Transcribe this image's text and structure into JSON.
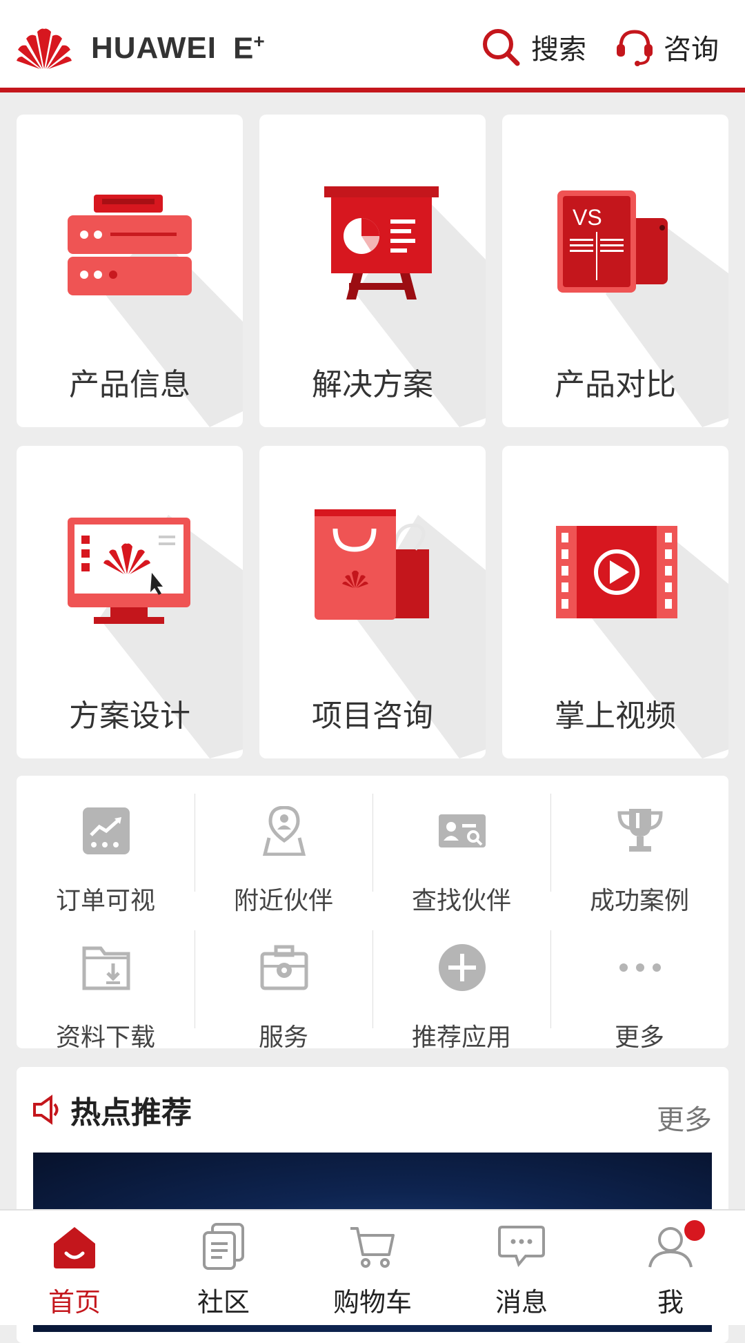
{
  "brand": {
    "name": "HUAWEI",
    "suffix": "E",
    "suffix_sup": "+"
  },
  "header": {
    "search_label": "搜索",
    "consult_label": "咨询"
  },
  "tiles": [
    {
      "label": "产品信息",
      "icon": "server-icon"
    },
    {
      "label": "解决方案",
      "icon": "presentation-board-icon"
    },
    {
      "label": "产品对比",
      "icon": "compare-phone-icon"
    },
    {
      "label": "方案设计",
      "icon": "monitor-design-icon"
    },
    {
      "label": "项目咨询",
      "icon": "shopping-bag-icon"
    },
    {
      "label": "掌上视频",
      "icon": "film-play-icon"
    }
  ],
  "quick": [
    {
      "label": "订单可视",
      "icon": "order-chart-icon"
    },
    {
      "label": "附近伙伴",
      "icon": "location-partner-icon"
    },
    {
      "label": "查找伙伴",
      "icon": "id-card-search-icon"
    },
    {
      "label": "成功案例",
      "icon": "trophy-icon"
    },
    {
      "label": "资料下载",
      "icon": "folder-download-icon"
    },
    {
      "label": "服务",
      "icon": "toolbox-gear-icon"
    },
    {
      "label": "推荐应用",
      "icon": "plus-circle-icon"
    },
    {
      "label": "更多",
      "icon": "more-dots-icon"
    }
  ],
  "hot": {
    "title": "热点推荐",
    "more": "更多"
  },
  "nav": [
    {
      "label": "首页",
      "icon": "home-icon",
      "active": true
    },
    {
      "label": "社区",
      "icon": "community-icon",
      "active": false
    },
    {
      "label": "购物车",
      "icon": "cart-icon",
      "active": false
    },
    {
      "label": "消息",
      "icon": "message-icon",
      "active": false
    },
    {
      "label": "我",
      "icon": "user-icon",
      "active": false
    }
  ],
  "colors": {
    "accent": "#c4161c",
    "icon_red": "#e94b4b",
    "gray_icon": "#b5b5b5"
  }
}
